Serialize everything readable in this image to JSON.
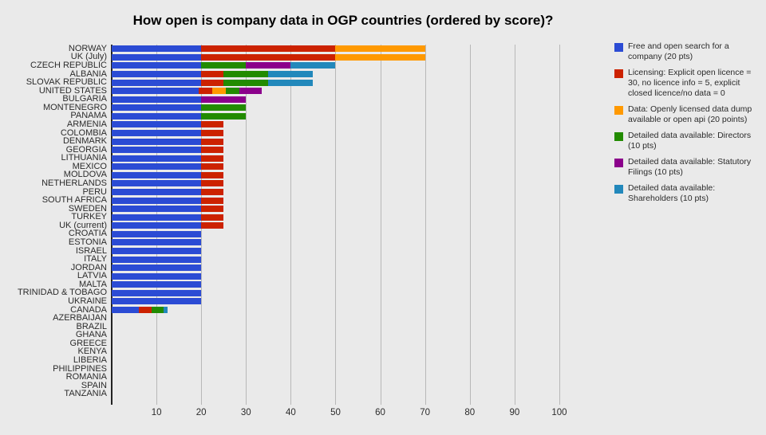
{
  "chart_data": {
    "type": "bar",
    "orientation": "horizontal",
    "stacked": true,
    "title": "How open is company data in OGP countries (ordered by score)?",
    "xlabel": "",
    "ylabel": "",
    "xlim": [
      0,
      105
    ],
    "grid": true,
    "legend_position": "right",
    "xticks": [
      "10",
      "20",
      "30",
      "40",
      "50",
      "60",
      "70",
      "80",
      "90",
      "100"
    ],
    "xtick_values": [
      10,
      20,
      30,
      40,
      50,
      60,
      70,
      80,
      90,
      100
    ],
    "categories": [
      "NORWAY",
      "UK (July)",
      "CZECH REPUBLIC",
      "ALBANIA",
      "SLOVAK REPUBLIC",
      "UNITED STATES",
      "BULGARIA",
      "MONTENEGRO",
      "PANAMA",
      "ARMENIA",
      "COLOMBIA",
      "DENMARK",
      "GEORGIA",
      "LITHUANIA",
      "MEXICO",
      "MOLDOVA",
      "NETHERLANDS",
      "PERU",
      "SOUTH AFRICA",
      "SWEDEN",
      "TURKEY",
      "UK (current)",
      "CROATIA",
      "ESTONIA",
      "ISRAEL",
      "ITALY",
      "JORDAN",
      "LATVIA",
      "MALTA",
      "TRINIDAD & TOBAGO",
      "UKRAINE",
      "CANADA",
      "AZERBAIJAN",
      "BRAZIL",
      "GHANA",
      "GREECE",
      "KENYA",
      "LIBERIA",
      "PHILIPPINES",
      "ROMANIA",
      "SPAIN",
      "TANZANIA"
    ],
    "series": [
      {
        "name": "Free and open search for a company (20 pts)",
        "color": "#2b4bd4",
        "values": [
          20,
          20,
          20,
          20,
          20,
          19.5,
          20,
          20,
          20,
          20,
          20,
          20,
          20,
          20,
          20,
          20,
          20,
          20,
          20,
          20,
          20,
          20,
          20,
          20,
          20,
          20,
          20,
          20,
          20,
          20,
          20,
          6,
          0,
          0,
          0,
          0,
          0,
          0,
          0,
          0,
          0,
          0
        ]
      },
      {
        "name": "Licensing: Explicit open licence = 30, no licence info = 5, explicit closed licence/no data = 0",
        "color": "#cc2200",
        "values": [
          30,
          30,
          0,
          5,
          5,
          3,
          0,
          0,
          0,
          5,
          5,
          5,
          5,
          5,
          5,
          5,
          5,
          5,
          5,
          5,
          5,
          5,
          0,
          0,
          0,
          0,
          0,
          0,
          0,
          0,
          0,
          3,
          0,
          0,
          0,
          0,
          0,
          0,
          0,
          0,
          0,
          0
        ]
      },
      {
        "name": "Data: Openly licensed data dump available or open api (20 points)",
        "color": "#ff9900",
        "values": [
          20,
          20,
          0,
          0,
          0,
          3,
          0,
          0,
          0,
          0,
          0,
          0,
          0,
          0,
          0,
          0,
          0,
          0,
          0,
          0,
          0,
          0,
          0,
          0,
          0,
          0,
          0,
          0,
          0,
          0,
          0,
          0,
          0,
          0,
          0,
          0,
          0,
          0,
          0,
          0,
          0,
          0
        ]
      },
      {
        "name": "Detailed data available: Directors (10 pts)",
        "color": "#228b00",
        "values": [
          0,
          0,
          10,
          10,
          10,
          3,
          0,
          10,
          10,
          0,
          0,
          0,
          0,
          0,
          0,
          0,
          0,
          0,
          0,
          0,
          0,
          0,
          0,
          0,
          0,
          0,
          0,
          0,
          0,
          0,
          0,
          2.5,
          0,
          0,
          0,
          0,
          0,
          0,
          0,
          0,
          0,
          0
        ]
      },
      {
        "name": "Detailed data available: Statutory Filings (10 pts)",
        "color": "#8b008b",
        "values": [
          0,
          0,
          10,
          0,
          0,
          5,
          10,
          0,
          0,
          0,
          0,
          0,
          0,
          0,
          0,
          0,
          0,
          0,
          0,
          0,
          0,
          0,
          0,
          0,
          0,
          0,
          0,
          0,
          0,
          0,
          0,
          0,
          0,
          0,
          0,
          0,
          0,
          0,
          0,
          0,
          0,
          0
        ]
      },
      {
        "name": "Detailed data available: Shareholders (10 pts)",
        "color": "#2288bb",
        "values": [
          0,
          0,
          10,
          10,
          10,
          0,
          0,
          0,
          0,
          0,
          0,
          0,
          0,
          0,
          0,
          0,
          0,
          0,
          0,
          0,
          0,
          0,
          0,
          0,
          0,
          0,
          0,
          0,
          0,
          0,
          0,
          1,
          0,
          0,
          0,
          0,
          0,
          0,
          0,
          0,
          0,
          0
        ]
      }
    ],
    "totals": [
      70,
      70,
      50,
      45,
      45,
      33.5,
      30,
      30,
      30,
      25,
      25,
      25,
      25,
      25,
      25,
      25,
      25,
      25,
      25,
      25,
      25,
      25,
      20,
      20,
      20,
      20,
      20,
      20,
      20,
      20,
      20,
      12.5,
      0,
      0,
      0,
      0,
      0,
      0,
      0,
      0,
      0,
      0
    ]
  },
  "colors": {
    "background": "#eaeaea",
    "gridline": "#b8b8b8",
    "axis": "#222222",
    "text": "#2b2b2b",
    "title": "#000000"
  }
}
